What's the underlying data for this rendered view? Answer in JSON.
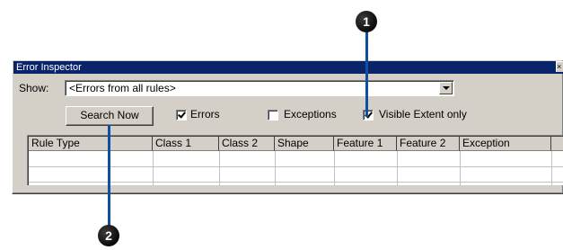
{
  "window": {
    "title": "Error Inspector",
    "close_glyph": "×"
  },
  "show": {
    "label": "Show:",
    "value": "<Errors from all rules>"
  },
  "search_button": {
    "label": "Search Now"
  },
  "checkboxes": [
    {
      "label": "Errors",
      "checked": true
    },
    {
      "label": "Exceptions",
      "checked": false
    },
    {
      "label": "Visible Extent only",
      "checked": true
    }
  ],
  "table": {
    "columns": [
      "Rule Type",
      "Class 1",
      "Class 2",
      "Shape",
      "Feature 1",
      "Feature 2",
      "Exception"
    ],
    "rows": []
  },
  "callouts": [
    "1",
    "2"
  ],
  "colors": {
    "callout_line": "#0d4fa0",
    "badge": "#111111",
    "title_bar": "#0a246a"
  }
}
